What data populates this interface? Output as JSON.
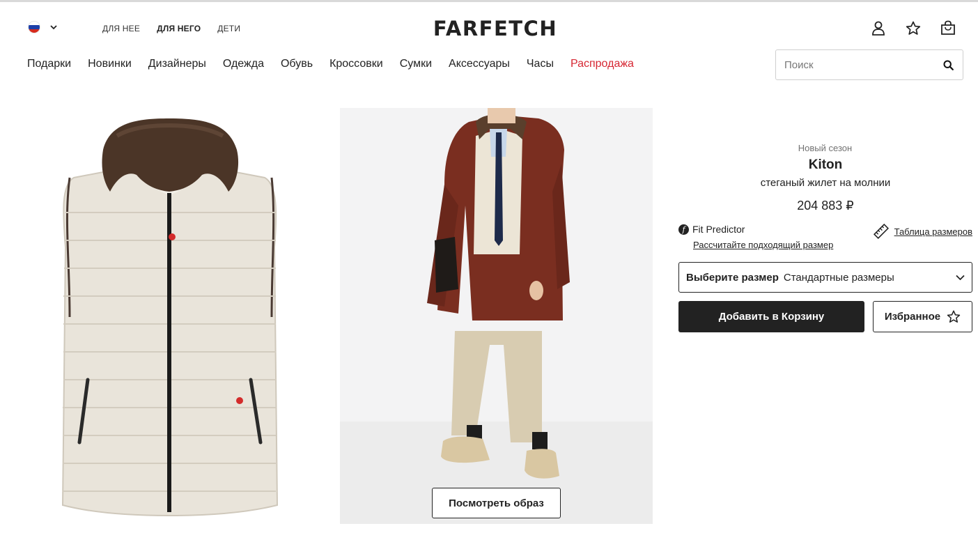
{
  "header": {
    "logo": "FARFETCH",
    "region": {
      "flag_colors": [
        "#ffffff",
        "#1c3fa8",
        "#d52b1e"
      ],
      "icon": "chevron-down-icon"
    },
    "gender_nav": [
      {
        "label": "ДЛЯ НЕЕ",
        "active": false
      },
      {
        "label": "ДЛЯ НЕГО",
        "active": true
      },
      {
        "label": "ДЕТИ",
        "active": false
      }
    ],
    "icons": [
      "account-icon",
      "wishlist-star-icon",
      "bag-icon"
    ]
  },
  "nav": {
    "items": [
      "Подарки",
      "Новинки",
      "Дизайнеры",
      "Одежда",
      "Обувь",
      "Кроссовки",
      "Сумки",
      "Аксессуары",
      "Часы"
    ],
    "sale": "Распродажа",
    "sale_color": "#d62632"
  },
  "search": {
    "placeholder": "Поиск",
    "value": "",
    "icon": "search-icon"
  },
  "gallery": {
    "look_button": "Посмотреть образ"
  },
  "product": {
    "season": "Новый сезон",
    "brand": "Kiton",
    "name": "стеганый жилет на молнии",
    "price": "204 883 ₽"
  },
  "fit": {
    "title": "Fit Predictor",
    "link": "Рассчитайте подходящий размер",
    "size_guide": "Таблица размеров"
  },
  "size_select": {
    "label": "Выберите размер",
    "value": "Стандартные размеры"
  },
  "actions": {
    "add_to_bag": "Добавить в Корзину",
    "wishlist": "Избранное"
  }
}
